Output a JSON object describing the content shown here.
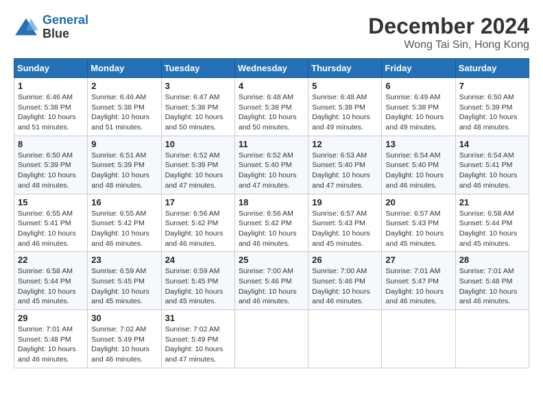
{
  "header": {
    "logo_line1": "General",
    "logo_line2": "Blue",
    "month": "December 2024",
    "location": "Wong Tai Sin, Hong Kong"
  },
  "days_of_week": [
    "Sunday",
    "Monday",
    "Tuesday",
    "Wednesday",
    "Thursday",
    "Friday",
    "Saturday"
  ],
  "weeks": [
    [
      {
        "day": "1",
        "sunrise": "6:46 AM",
        "sunset": "5:38 PM",
        "daylight": "10 hours and 51 minutes."
      },
      {
        "day": "2",
        "sunrise": "6:46 AM",
        "sunset": "5:38 PM",
        "daylight": "10 hours and 51 minutes."
      },
      {
        "day": "3",
        "sunrise": "6:47 AM",
        "sunset": "5:38 PM",
        "daylight": "10 hours and 50 minutes."
      },
      {
        "day": "4",
        "sunrise": "6:48 AM",
        "sunset": "5:38 PM",
        "daylight": "10 hours and 50 minutes."
      },
      {
        "day": "5",
        "sunrise": "6:48 AM",
        "sunset": "5:38 PM",
        "daylight": "10 hours and 49 minutes."
      },
      {
        "day": "6",
        "sunrise": "6:49 AM",
        "sunset": "5:38 PM",
        "daylight": "10 hours and 49 minutes."
      },
      {
        "day": "7",
        "sunrise": "6:50 AM",
        "sunset": "5:39 PM",
        "daylight": "10 hours and 48 minutes."
      }
    ],
    [
      {
        "day": "8",
        "sunrise": "6:50 AM",
        "sunset": "5:39 PM",
        "daylight": "10 hours and 48 minutes."
      },
      {
        "day": "9",
        "sunrise": "6:51 AM",
        "sunset": "5:39 PM",
        "daylight": "10 hours and 48 minutes."
      },
      {
        "day": "10",
        "sunrise": "6:52 AM",
        "sunset": "5:39 PM",
        "daylight": "10 hours and 47 minutes."
      },
      {
        "day": "11",
        "sunrise": "6:52 AM",
        "sunset": "5:40 PM",
        "daylight": "10 hours and 47 minutes."
      },
      {
        "day": "12",
        "sunrise": "6:53 AM",
        "sunset": "5:40 PM",
        "daylight": "10 hours and 47 minutes."
      },
      {
        "day": "13",
        "sunrise": "6:54 AM",
        "sunset": "5:40 PM",
        "daylight": "10 hours and 46 minutes."
      },
      {
        "day": "14",
        "sunrise": "6:54 AM",
        "sunset": "5:41 PM",
        "daylight": "10 hours and 46 minutes."
      }
    ],
    [
      {
        "day": "15",
        "sunrise": "6:55 AM",
        "sunset": "5:41 PM",
        "daylight": "10 hours and 46 minutes."
      },
      {
        "day": "16",
        "sunrise": "6:55 AM",
        "sunset": "5:42 PM",
        "daylight": "10 hours and 46 minutes."
      },
      {
        "day": "17",
        "sunrise": "6:56 AM",
        "sunset": "5:42 PM",
        "daylight": "10 hours and 46 minutes."
      },
      {
        "day": "18",
        "sunrise": "6:56 AM",
        "sunset": "5:42 PM",
        "daylight": "10 hours and 46 minutes."
      },
      {
        "day": "19",
        "sunrise": "6:57 AM",
        "sunset": "5:43 PM",
        "daylight": "10 hours and 45 minutes."
      },
      {
        "day": "20",
        "sunrise": "6:57 AM",
        "sunset": "5:43 PM",
        "daylight": "10 hours and 45 minutes."
      },
      {
        "day": "21",
        "sunrise": "6:58 AM",
        "sunset": "5:44 PM",
        "daylight": "10 hours and 45 minutes."
      }
    ],
    [
      {
        "day": "22",
        "sunrise": "6:58 AM",
        "sunset": "5:44 PM",
        "daylight": "10 hours and 45 minutes."
      },
      {
        "day": "23",
        "sunrise": "6:59 AM",
        "sunset": "5:45 PM",
        "daylight": "10 hours and 45 minutes."
      },
      {
        "day": "24",
        "sunrise": "6:59 AM",
        "sunset": "5:45 PM",
        "daylight": "10 hours and 45 minutes."
      },
      {
        "day": "25",
        "sunrise": "7:00 AM",
        "sunset": "5:46 PM",
        "daylight": "10 hours and 46 minutes."
      },
      {
        "day": "26",
        "sunrise": "7:00 AM",
        "sunset": "5:46 PM",
        "daylight": "10 hours and 46 minutes."
      },
      {
        "day": "27",
        "sunrise": "7:01 AM",
        "sunset": "5:47 PM",
        "daylight": "10 hours and 46 minutes."
      },
      {
        "day": "28",
        "sunrise": "7:01 AM",
        "sunset": "5:48 PM",
        "daylight": "10 hours and 46 minutes."
      }
    ],
    [
      {
        "day": "29",
        "sunrise": "7:01 AM",
        "sunset": "5:48 PM",
        "daylight": "10 hours and 46 minutes."
      },
      {
        "day": "30",
        "sunrise": "7:02 AM",
        "sunset": "5:49 PM",
        "daylight": "10 hours and 46 minutes."
      },
      {
        "day": "31",
        "sunrise": "7:02 AM",
        "sunset": "5:49 PM",
        "daylight": "10 hours and 47 minutes."
      },
      null,
      null,
      null,
      null
    ]
  ]
}
